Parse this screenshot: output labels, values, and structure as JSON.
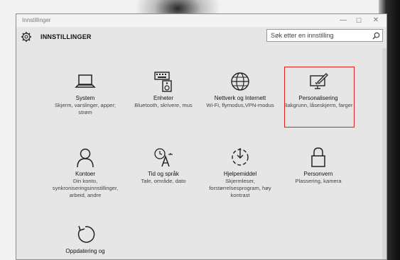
{
  "window": {
    "title": "Innstillinger",
    "min_glyph": "—",
    "max_glyph": "☐",
    "close_glyph": "✕"
  },
  "header": {
    "app_title": "INNSTILLINGER"
  },
  "search": {
    "placeholder": "Søk etter en innstilling"
  },
  "tiles": [
    {
      "name": "System",
      "desc": "Skjerm, varslinger, apper; strøm"
    },
    {
      "name": "Enheter",
      "desc": "Bluetooth, skrivere, mus"
    },
    {
      "name": "Nettverk og Internett",
      "desc": "Wi-Fi, flymodus,VPN-modus"
    },
    {
      "name": "Personalisering",
      "desc": "Bakgrunn, låseskjerm, farger"
    },
    {
      "name": "Kontoer",
      "desc": "Din konto, synkroniseringsinnstillinger, arbeid, andre"
    },
    {
      "name": "Tid og språk",
      "desc": "Tale, område, dato"
    },
    {
      "name": "Hjelpemiddel",
      "desc": "Skjermleser, forstørrelsesprogram, høy kontrast"
    },
    {
      "name": "Personvern",
      "desc": "Plassering, kamera"
    },
    {
      "name": "Oppdatering og",
      "desc": ""
    }
  ],
  "colors": {
    "highlight": "#e02020",
    "window_bg": "#e6e6e6"
  }
}
